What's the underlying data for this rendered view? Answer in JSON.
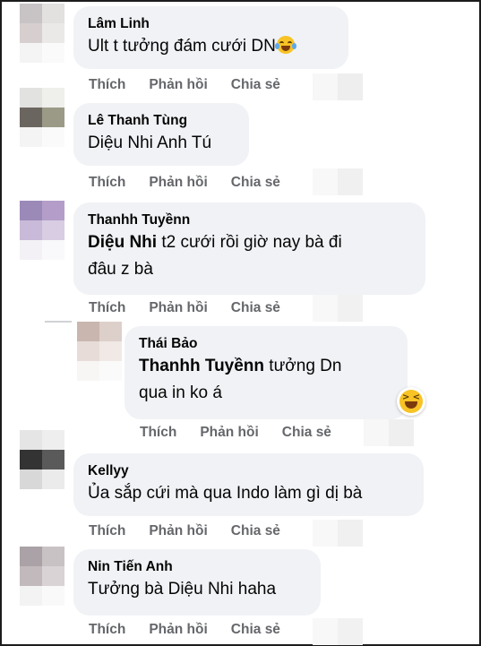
{
  "comments": [
    {
      "author": "Lâm Linh",
      "text": "Ult t tưởng đám cưới DN",
      "emoji": "face-with-tears-of-joy-emoji",
      "actions": {
        "like": "Thích",
        "reply": "Phản hồi",
        "share": "Chia sẻ"
      }
    },
    {
      "author": "Lê Thanh Tùng",
      "text": "Diệu Nhi Anh Tú",
      "actions": {
        "like": "Thích",
        "reply": "Phản hồi",
        "share": "Chia sẻ"
      }
    },
    {
      "author": "Thanhh Tuyềnn",
      "mention": "Diệu Nhi",
      "text_line1": " t2 cưới rồi giờ nay bà đi",
      "text_line2": "đâu z bà",
      "actions": {
        "like": "Thích",
        "reply": "Phản hồi",
        "share": "Chia sẻ"
      }
    },
    {
      "author": "Thái Bảo",
      "mention": "Thanhh Tuyềnn",
      "text_line1": " tưởng Dn",
      "text_line2": "qua in ko á",
      "reaction": "laughing-squinting-face-emoji",
      "actions": {
        "like": "Thích",
        "reply": "Phản hồi",
        "share": "Chia sẻ"
      }
    },
    {
      "author": "Kellyy",
      "text": "Ủa sắp cứi mà qua Indo làm gì dị bà",
      "actions": {
        "like": "Thích",
        "reply": "Phản hồi",
        "share": "Chia sẻ"
      }
    },
    {
      "author": "Nin Tiến Anh",
      "text": "Tưởng bà Diệu Nhi haha",
      "actions": {
        "like": "Thích",
        "reply": "Phản hồi",
        "share": "Chia sẻ"
      }
    }
  ],
  "colors": {
    "bubble": "#f0f2f5",
    "action_text": "#65676b",
    "author_text": "#050505"
  }
}
